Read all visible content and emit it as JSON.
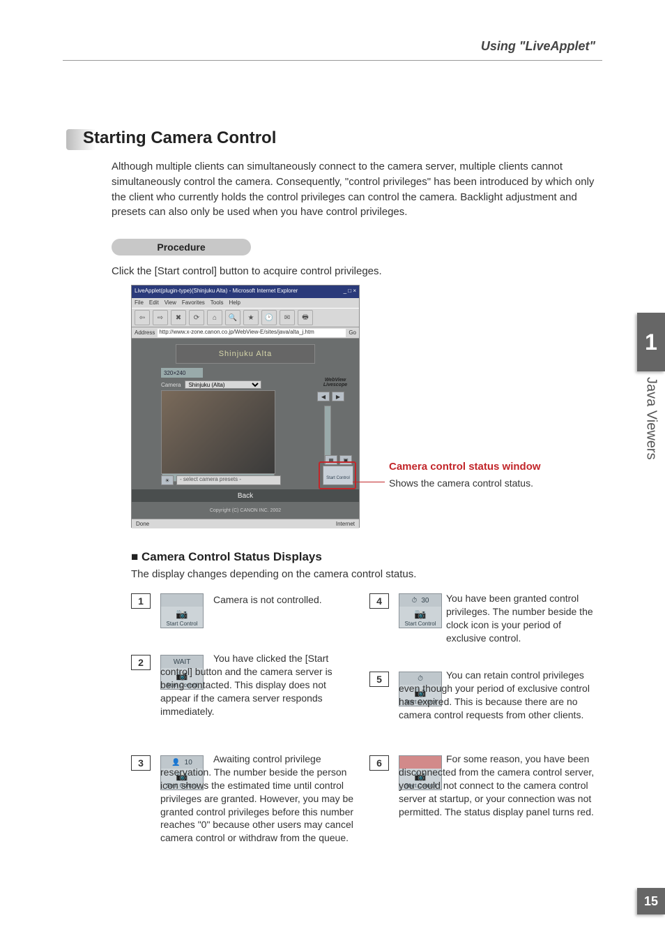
{
  "header": {
    "title": "Using \"LiveApplet\""
  },
  "section": {
    "title": "Starting Camera Control",
    "intro": "Although multiple clients can simultaneously connect to the camera server, multiple clients cannot simultaneously control the camera. Consequently, \"control privileges\" has been introduced by which only the client who currently holds the control privileges can control the camera. Backlight adjustment and presets can also only be used when you have control privileges.",
    "procedure_label": "Procedure",
    "click_instruction": "Click the [Start control] button to acquire control privileges."
  },
  "screenshot": {
    "window_title": "LiveApplet(plugin-type)(Shinjuku Alta) - Microsoft Internet Explorer",
    "menus": [
      "File",
      "Edit",
      "View",
      "Favorites",
      "Tools",
      "Help"
    ],
    "toolbar": {
      "back": "Back",
      "forward": "Forward",
      "stop": "Stop",
      "refresh": "Refresh",
      "home": "Home",
      "search": "Search",
      "favorites": "Favorites",
      "history": "History",
      "mail": "Mail",
      "print": "Print"
    },
    "address_label": "Address",
    "address_url": "http://www.x-zone.canon.co.jp/WebView-E/sites/java/alta_j.htm",
    "go_label": "Go",
    "banner": "Shinjuku Alta",
    "size_label": "320×240",
    "camera_label": "Camera",
    "camera_option": "Shinjuku (Alta)",
    "webview_brand": "WebView Livescope",
    "preset_placeholder": "- select camera presets -",
    "back_button": "Back",
    "copyright": "Copyright (C) CANON INC. 2002",
    "status_left": "Done",
    "status_right": "Internet",
    "start_control": "Start Control"
  },
  "callout": {
    "title": "Camera control status window",
    "subtitle": "Shows the camera control status."
  },
  "status_section": {
    "heading": "■ Camera Control Status Displays",
    "subheading": "The display changes depending on the camera control status.",
    "items": [
      {
        "num": "1",
        "text": "Camera is not controlled.",
        "panel_label": "Start Control"
      },
      {
        "num": "2",
        "text": "You have clicked the [Start control] button and the camera server is being contacted. This display does not appear if the camera server responds immediately.",
        "panel_top": "WAIT",
        "panel_label": "Start Control"
      },
      {
        "num": "3",
        "text": "Awaiting control privilege reservation. The number beside the person icon shows the estimated time until control privileges are granted. However, you may be granted control privileges before this number reaches \"0\" because other users may cancel camera control or withdraw from the queue.",
        "panel_value": "10",
        "panel_label": "Start Control"
      },
      {
        "num": "4",
        "text": "You have been granted control privileges. The number beside the clock icon is your period of exclusive control.",
        "panel_value": "30",
        "panel_label": "Start Control"
      },
      {
        "num": "5",
        "text": "You can retain control privileges even though your period of exclusive control has expired. This is because there are no camera control requests from other clients.",
        "panel_label": "Start Control"
      },
      {
        "num": "6",
        "text": "For some reason, you have been disconnected from the camera control server, you could not connect to the camera control server at startup, or your connection was not permitted. The status display panel turns red.",
        "panel_label": "Start Control"
      }
    ]
  },
  "side": {
    "chapter": "1",
    "label": "Java Viewers",
    "page": "15"
  }
}
